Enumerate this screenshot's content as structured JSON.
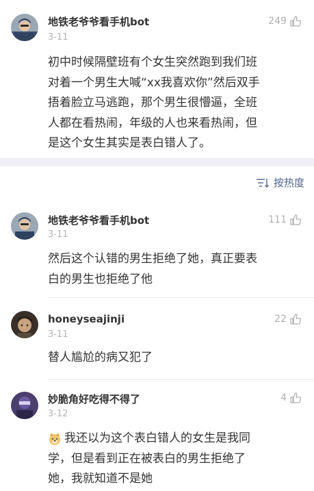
{
  "main_post": {
    "username": "地铁老爷爷看手机bot",
    "date": "3-11",
    "likes": "249",
    "text": "初中时候隔壁班有个女生突然跑到我们班\n对着一个男生大喊“xx我喜欢你”然后双手\n捂着脸立马逃跑，那个男生很懵逼，全班\n人都在看热闹，年级的人也来看热闹，但\n是这个女生其实是表白错人了。"
  },
  "sort": {
    "label": "按热度",
    "icon": "sort-icon"
  },
  "comments": [
    {
      "username": "地铁老爷爷看手机bot",
      "date": "3-11",
      "likes": "111",
      "text": "然后这个认错的男生拒绝了她，真正要表\n白的男生也拒绝了他"
    },
    {
      "username": "honeyseajinji",
      "date": "3-11",
      "likes": "22",
      "text": "替人尴尬的病又犯了"
    },
    {
      "username": "妙脆角好吃得不得了",
      "date": "3-12",
      "likes": "4",
      "text": "我还以为这个表白错人的女生是我同\n学，但是看到正在被表白的男生拒绝了\n她，我就知道不是她"
    }
  ],
  "colors": {
    "link": "#50648c",
    "meta": "#b4b4b4",
    "band": "#efeff4"
  }
}
